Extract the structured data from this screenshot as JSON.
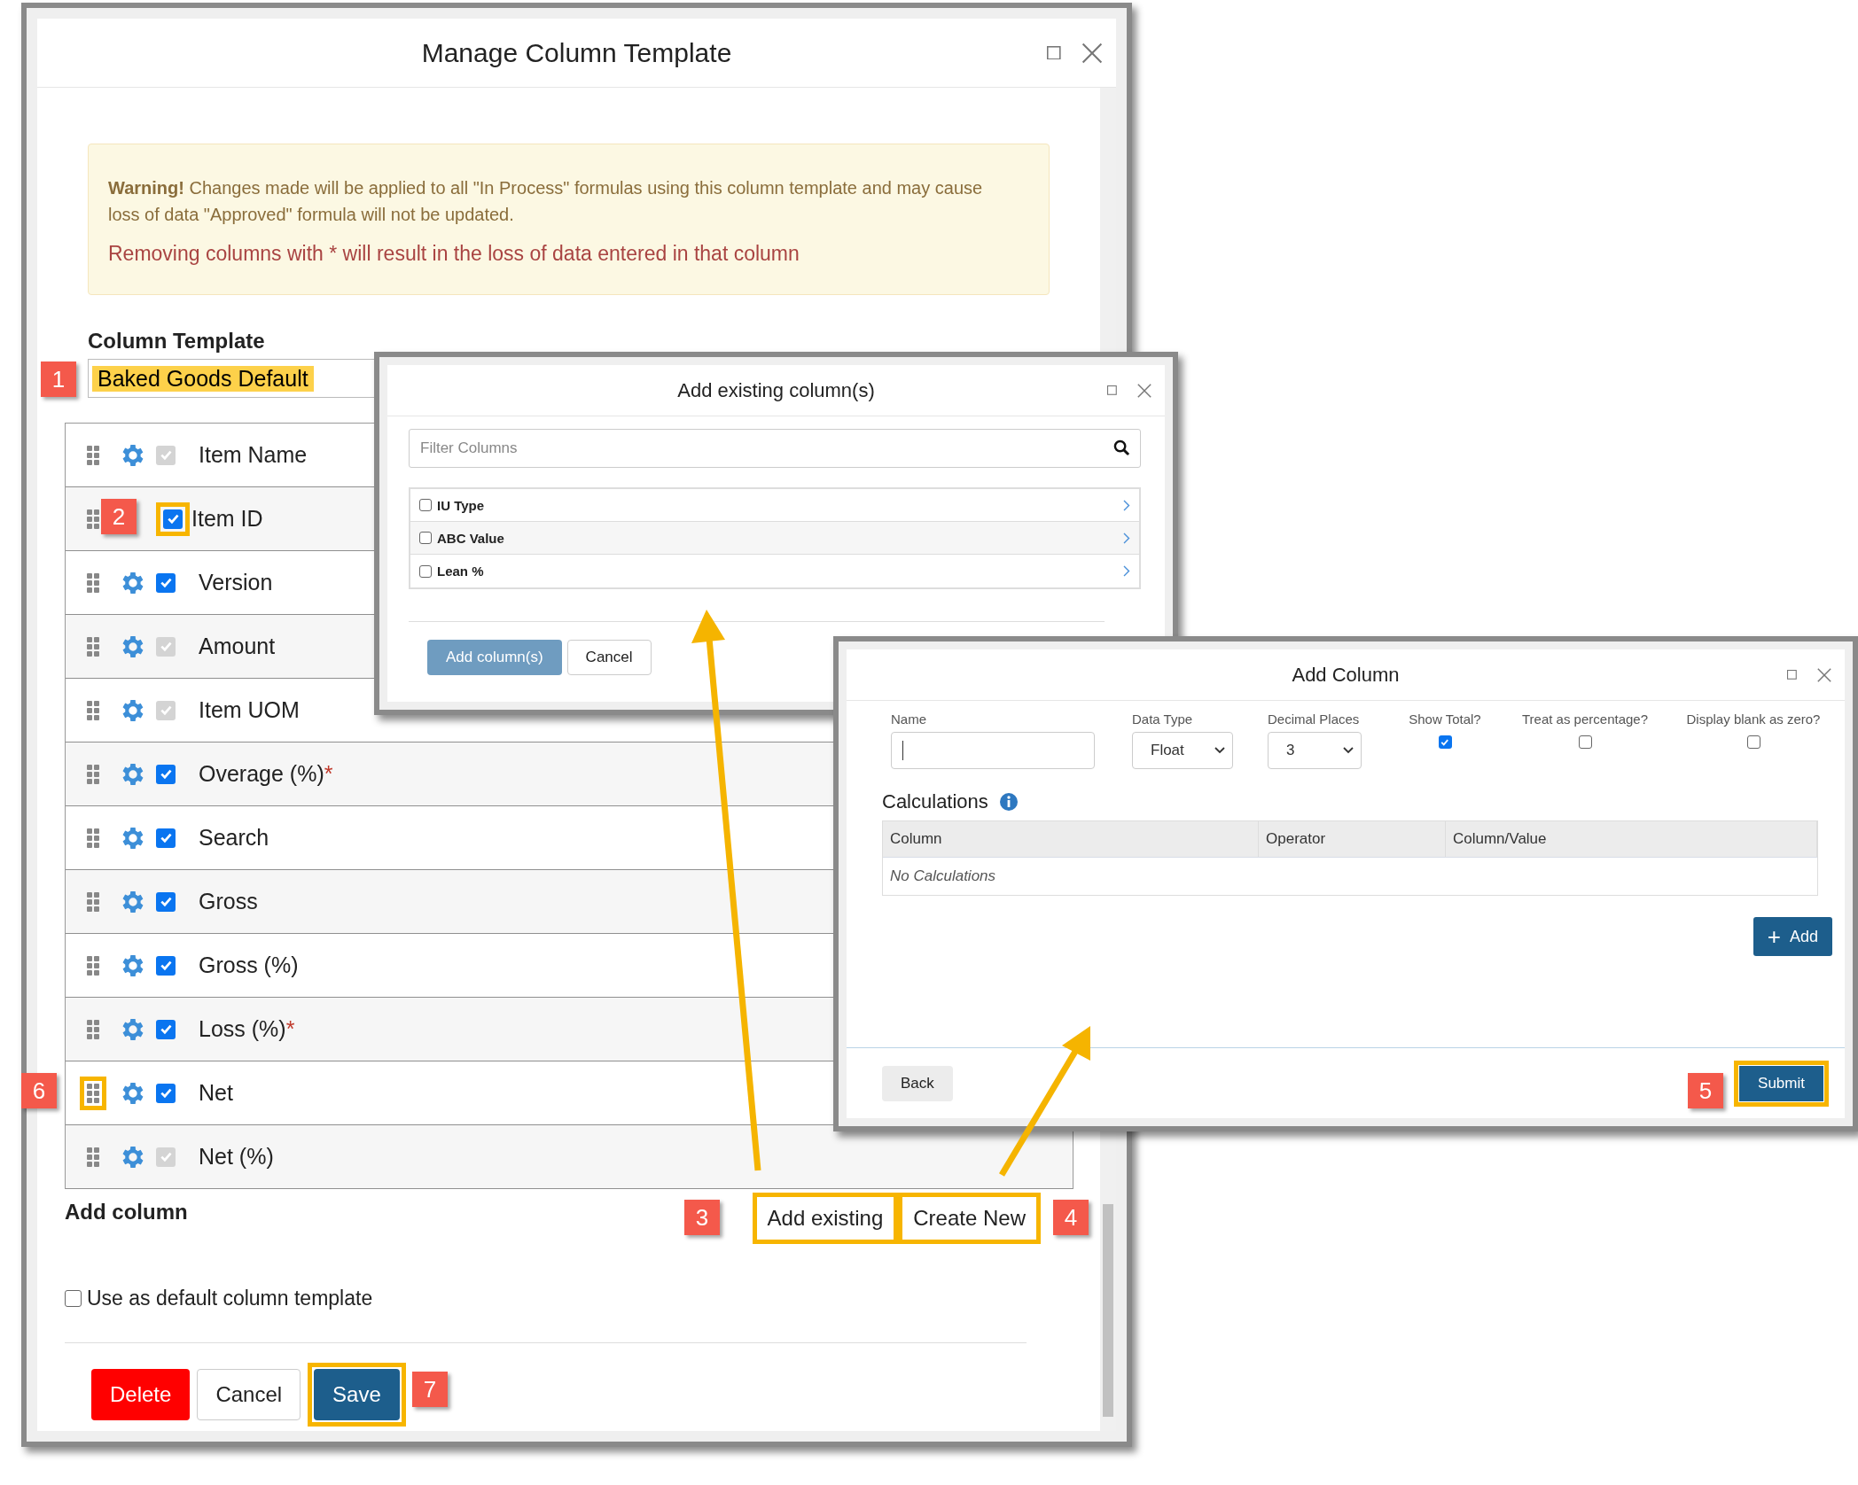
{
  "main_window": {
    "title": "Manage Column Template",
    "warning": {
      "text": "**Warning!** Changes made will be applied to all \"In Process\" formulas using this column template and may cause loss of data \"Approved\" formula will not be updated.",
      "note": "Removing columns with * will result in the loss of data entered in that column"
    },
    "template_label": "Column Template",
    "template_name": "Baked Goods Default",
    "template_name_highlighted": true,
    "columns": [
      {
        "label": "Item Name",
        "checked": true,
        "disabled": true,
        "gear": true
      },
      {
        "label": "Item ID",
        "checked": true,
        "disabled": false,
        "gear": false,
        "highlighted": true
      },
      {
        "label": "Version",
        "checked": true,
        "disabled": false,
        "gear": true
      },
      {
        "label": "Amount",
        "checked": true,
        "disabled": true,
        "gear": true
      },
      {
        "label": "Item UOM",
        "checked": true,
        "disabled": true,
        "gear": true
      },
      {
        "label": "Overage (%)",
        "marker": "*",
        "checked": true,
        "disabled": false,
        "gear": true
      },
      {
        "label": "Search",
        "checked": true,
        "disabled": false,
        "gear": true
      },
      {
        "label": "Gross",
        "checked": true,
        "disabled": false,
        "gear": true
      },
      {
        "label": "Gross (%)",
        "checked": true,
        "disabled": false,
        "gear": true
      },
      {
        "label": "Loss (%)",
        "marker": "*",
        "checked": true,
        "disabled": false,
        "gear": true
      },
      {
        "label": "Net",
        "checked": true,
        "disabled": false,
        "gear": true,
        "handle_highlighted": true
      },
      {
        "label": "Net (%)",
        "checked": true,
        "disabled": true,
        "gear": true
      }
    ],
    "add_column_label": "Add column",
    "add_buttons": [
      {
        "label": "Add existing",
        "highlighted": true
      },
      {
        "label": "Create New",
        "highlighted": true
      }
    ],
    "default_template": {
      "label": "Use as default column template",
      "checked": false
    },
    "buttons": [
      {
        "label": "Delete",
        "kind": "danger"
      },
      {
        "label": "Cancel",
        "kind": "default"
      },
      {
        "label": "Save",
        "kind": "primary",
        "highlighted": true
      }
    ]
  },
  "add_existing_dialog": {
    "title": "Add existing column(s)",
    "filter": {
      "placeholder": "Filter Columns"
    },
    "items": [
      {
        "label": "IU Type",
        "checked": false
      },
      {
        "label": "ABC Value",
        "checked": false
      },
      {
        "label": "Lean %",
        "checked": false
      }
    ],
    "buttons": [
      {
        "label": "Add column(s)",
        "kind": "primary"
      },
      {
        "label": "Cancel",
        "kind": "default"
      }
    ]
  },
  "add_column_dialog": {
    "title": "Add Column",
    "name": {
      "label": "Name"
    },
    "data_type": {
      "label": "Data Type",
      "value": "Float"
    },
    "decimal_places": {
      "label": "Decimal Places",
      "value": "3"
    },
    "options": [
      {
        "label": "Show Total?",
        "checked": true
      },
      {
        "label": "Treat as percentage?",
        "checked": false
      },
      {
        "label": "Display blank as zero?",
        "checked": false
      }
    ],
    "calculations": {
      "title": "Calculations",
      "columns": [
        "Column",
        "Operator",
        "Column/Value"
      ],
      "empty": "No Calculations"
    },
    "add_button": {
      "icon": "+",
      "label": "Add"
    },
    "back_button": "Back",
    "submit_button": {
      "label": "Submit",
      "highlighted": true
    }
  },
  "annotations": {
    "badges": [
      "1",
      "2",
      "3",
      "4",
      "5",
      "6",
      "7"
    ]
  }
}
